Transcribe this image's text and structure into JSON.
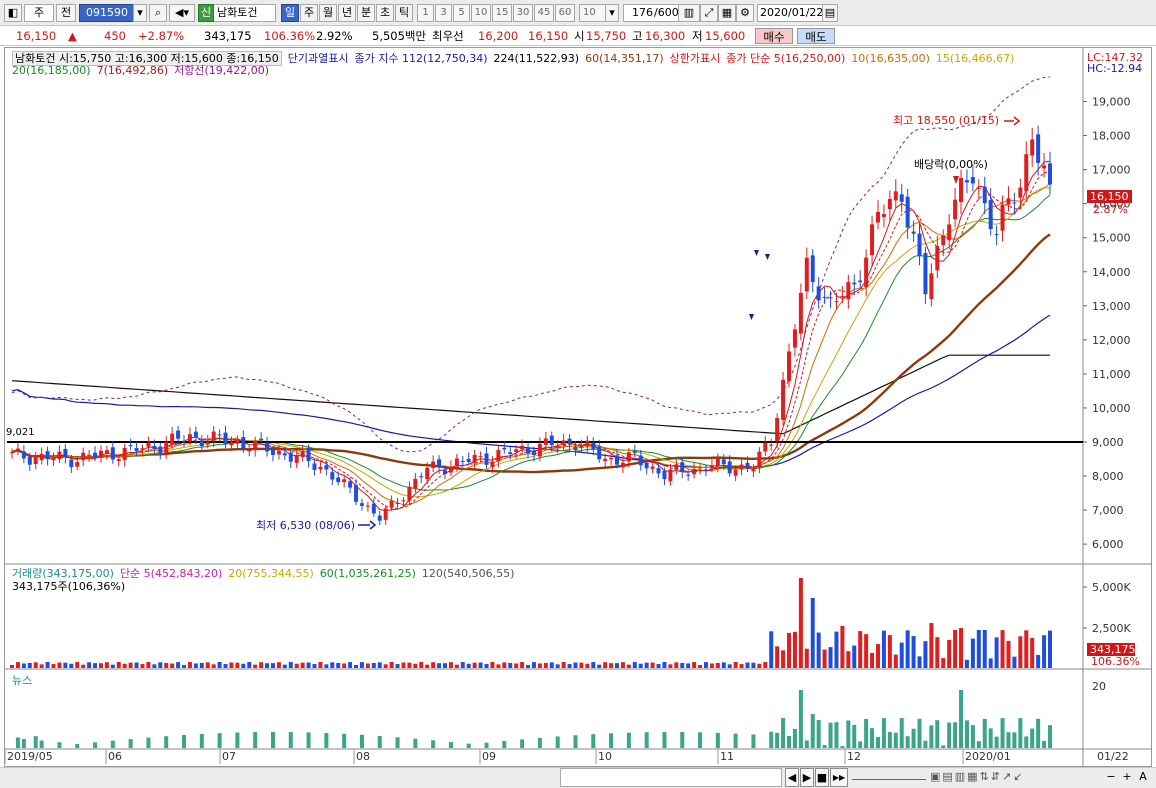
{
  "toolbar": {
    "market": "주",
    "prev": "전",
    "code": "091590",
    "credit_badge": "신",
    "name": "남화토건",
    "periods": [
      "일",
      "주",
      "월",
      "년",
      "분",
      "초",
      "틱"
    ],
    "intervals": [
      "1",
      "3",
      "5",
      "10",
      "15",
      "30",
      "45",
      "60"
    ],
    "interval_value": "10",
    "count": "176",
    "count_total": "/600",
    "date": "2020/01/22",
    "icons": [
      "menu-icon",
      "search-icon",
      "sound-icon",
      "chart-settings-icon",
      "expand-icon",
      "gear-icon",
      "calendar-icon"
    ]
  },
  "quote": {
    "price": "16,150",
    "arrow": "▲",
    "change": "450",
    "change_pct": "+2.87%",
    "volume": "343,175",
    "volume_ratio": "106.36%",
    "turnover": "2.92%",
    "amount": "5,505백만",
    "best_ask_label": "최우선",
    "best_ask": "16,200",
    "best_bid": "16,150",
    "open_label": "시",
    "open": "15,750",
    "high_label": "고",
    "high": "16,300",
    "low_label": "저",
    "low": "15,600",
    "buy_label": "매수",
    "sell_label": "매도"
  },
  "legend": {
    "line1": [
      {
        "text": "남화토건 시:15,750 고:16,300 저:15,600 종:16,150",
        "color": "#000000"
      },
      {
        "text": "단기과열표시",
        "color": "#1a1aa8"
      },
      {
        "text": "종가 지수 112(12,750,34)",
        "color": "#1a1aa8"
      },
      {
        "text": "224(11,522,93)",
        "color": "#000000"
      },
      {
        "text": "60(14,351,17)",
        "color": "#8b3a0c"
      },
      {
        "text": "상한가표시",
        "color": "#d01818"
      },
      {
        "text": "종가 단순 5(16,250,00)",
        "color": "#d01818"
      },
      {
        "text": "10(16,635,00)",
        "color": "#d06a00"
      },
      {
        "text": "15(16,466,67)",
        "color": "#c8a800"
      }
    ],
    "line2": [
      {
        "text": "20(16,185,00)",
        "color": "#1a8a2a"
      },
      {
        "text": "7(16,492,86)",
        "color": "#a01e1e"
      },
      {
        "text": "저항선(19,422,00)",
        "color": "#8a1a8a"
      }
    ],
    "volume": [
      {
        "text": "거래량(343,175,00)",
        "color": "#1f8a8a"
      },
      {
        "text": "단순 5(452,843,20)",
        "color": "#c81eaa"
      },
      {
        "text": "20(755,344,55)",
        "color": "#c8a800"
      },
      {
        "text": "60(1,035,261,25)",
        "color": "#1a8a2a"
      },
      {
        "text": "120(540,506,55)",
        "color": "#555555"
      }
    ],
    "volume2": "343,175주(106,36%)",
    "news": "뉴스"
  },
  "right_labels": {
    "lc": "LC:147.32",
    "hc": "HC:-12.94",
    "price_tag": "16,150",
    "pct_tag": "2.87%",
    "vol_tag": "343,175",
    "vol_pct_tag": "106.36%"
  },
  "annotations": {
    "high": "최고 18,550 (01/15)",
    "low": "최저 6,530 (08/06)",
    "dividend": "배당락(0,00%)",
    "hline_label": "9,021"
  },
  "bottom": {
    "date_tag": "01/22",
    "buttons": [
      "◀",
      "▶",
      "■",
      "▶▶"
    ],
    "zoom_minus": "−",
    "zoom_plus": "+",
    "font_btn": "A"
  },
  "chart_data": {
    "type": "candlestick",
    "price_axis": {
      "ticks": [
        6000,
        7000,
        8000,
        9000,
        10000,
        11000,
        12000,
        13000,
        14000,
        15000,
        16000,
        17000,
        18000,
        19000
      ],
      "labels": [
        "6,000",
        "7,000",
        "8,000",
        "9,000",
        "10,000",
        "11,000",
        "12,000",
        "13,000",
        "14,000",
        "15,000",
        "16,000",
        "17,000",
        "18,000",
        "19,000"
      ]
    },
    "volume_axis": {
      "labels": [
        "5,000K",
        "2,500K"
      ]
    },
    "news_axis": {
      "labels": [
        "20"
      ]
    },
    "x_labels": [
      "2019/05",
      "06",
      "07",
      "08",
      "09",
      "10",
      "11",
      "12",
      "2020/01"
    ],
    "hline": 9000,
    "high": 18550,
    "low": 6530,
    "last_close": 16150,
    "ma_colors": {
      "ma5": "#d01818",
      "ma10": "#d06a00",
      "ma15": "#c8a800",
      "ma20": "#1a8a2a",
      "ma60": "#8b3a0c",
      "ma112": "#1a1aa8",
      "ma224": "#111111",
      "resistance": "#8a1a8a"
    },
    "up_color": "#e01e1e",
    "down_color": "#1e4ee0"
  }
}
